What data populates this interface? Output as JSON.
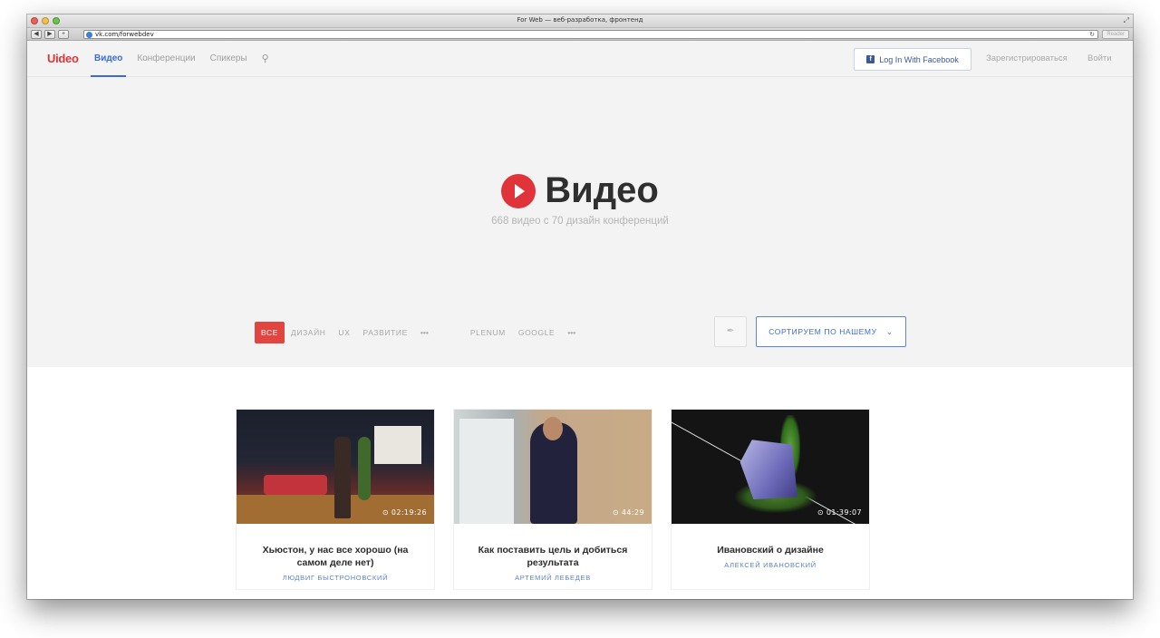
{
  "browser": {
    "window_title": "For Web — веб-разработка, фронтенд",
    "url": "vk.com/forwebdev",
    "reader_label": "Reader",
    "back_label": "◀",
    "forward_label": "▶",
    "add_label": "+"
  },
  "nav": {
    "logo": "Uideo",
    "links": [
      "Видео",
      "Конференции",
      "Спикеры"
    ],
    "facebook_label": "Log In With Facebook",
    "register_label": "Зарегистрироваться",
    "login_label": "Войти"
  },
  "hero": {
    "title": "Видео",
    "subtitle": "668 видео с 70 дизайн конференций"
  },
  "filters": {
    "categories": [
      "ВСЕ",
      "ДИЗАЙН",
      "UX",
      "РАЗВИТИЕ",
      "•••"
    ],
    "sources": [
      "PLENUM",
      "GOOGLE",
      "•••"
    ],
    "sort_label": "СОРТИРУЕМ ПО НАШЕМУ"
  },
  "videos": [
    {
      "title": "Хьюстон, у нас все хорошо (на самом деле нет)",
      "author": "ЛЮДВИГ БЫСТРОНОВСКИЙ",
      "duration": "⊙ 02:19:26"
    },
    {
      "title": "Как поставить цель и добиться результата",
      "author": "АРТЕМИЙ ЛЕБЕДЕВ",
      "duration": "⊙ 44:29"
    },
    {
      "title": "Ивановский о дизайне",
      "author": "АЛЕКСЕЙ ИВАНОВСКИЙ",
      "duration": "⊙ 01:39:07"
    }
  ],
  "colors": {
    "brand_red": "#e0343a",
    "accent_blue": "#3a6bd8",
    "facebook_blue": "#3b5998"
  }
}
